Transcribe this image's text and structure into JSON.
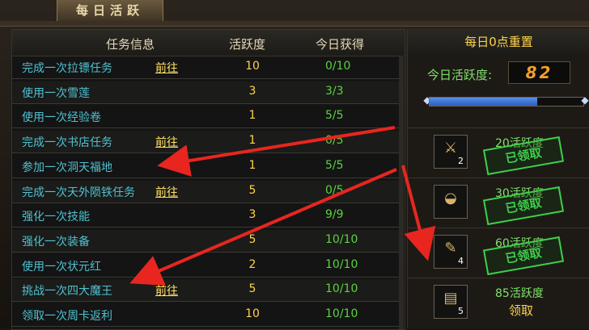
{
  "window": {
    "title": "每日活跃"
  },
  "table": {
    "headers": [
      "任务信息",
      "活跃度",
      "今日获得"
    ],
    "rows": [
      {
        "name": "完成一次拉镖任务",
        "go": "前往",
        "points": "10",
        "progress": "0/10"
      },
      {
        "name": "使用一次雪莲",
        "go": "",
        "points": "3",
        "progress": "3/3"
      },
      {
        "name": "使用一次经验卷",
        "go": "",
        "points": "1",
        "progress": "5/5"
      },
      {
        "name": "完成一次书店任务",
        "go": "前往",
        "points": "1",
        "progress": "0/5"
      },
      {
        "name": "参加一次洞天福地",
        "go": "",
        "points": "1",
        "progress": "5/5"
      },
      {
        "name": "完成一次天外陨铁任务",
        "go": "前往",
        "points": "5",
        "progress": "0/5"
      },
      {
        "name": "强化一次技能",
        "go": "",
        "points": "3",
        "progress": "9/9"
      },
      {
        "name": "强化一次装备",
        "go": "",
        "points": "5",
        "progress": "10/10"
      },
      {
        "name": "使用一次状元红",
        "go": "",
        "points": "2",
        "progress": "10/10"
      },
      {
        "name": "挑战一次四大魔王",
        "go": "前往",
        "points": "5",
        "progress": "10/10"
      },
      {
        "name": "领取一次周卡返利",
        "go": "",
        "points": "10",
        "progress": "10/10"
      }
    ]
  },
  "side": {
    "reset_text": "每日0点重置",
    "today_label": "今日活跃度:",
    "today_value": "82",
    "bar_fraction": 0.7,
    "rewards": [
      {
        "label": "20活跃度",
        "count": "2",
        "status": "已领取",
        "claimed": true,
        "icon": "sword-orb-icon"
      },
      {
        "label": "30活跃度",
        "count": "",
        "status": "已领取",
        "claimed": true,
        "icon": "rice-bowl-icon"
      },
      {
        "label": "60活跃度",
        "count": "4",
        "status": "已领取",
        "claimed": true,
        "icon": "scroll-icon"
      },
      {
        "label": "85活跃度",
        "count": "5",
        "status": "领取",
        "claimed": false,
        "icon": "map-scroll-icon"
      }
    ]
  },
  "colors": {
    "task": "#4fc1d0",
    "go": "#ffe066",
    "points": "#ffd34d",
    "progress": "#5bd341",
    "stamp": "#3ecf4a",
    "arrow": "#e8261f"
  }
}
